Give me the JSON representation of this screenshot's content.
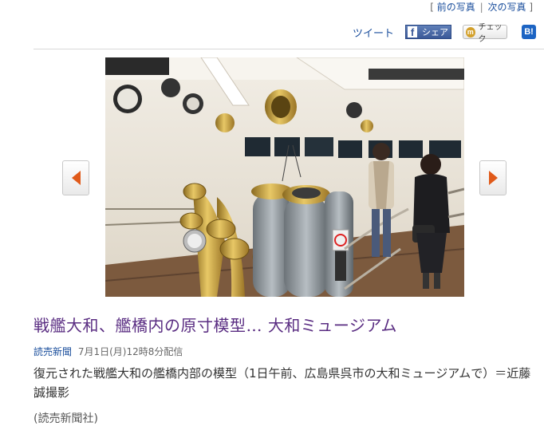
{
  "topnav": {
    "open_bracket": "[",
    "prev_label": "前の写真",
    "separator": "|",
    "next_label": "次の写真",
    "close_bracket": "]"
  },
  "share": {
    "tweet_label": "ツイート",
    "facebook_label": "シェア",
    "mixi_label": "チェック",
    "hatena_label": "B!"
  },
  "article": {
    "headline": "戦艦大和、艦橋内の原寸模型… 大和ミュージアム",
    "source": "読売新聞",
    "date": "7月1日(月)12時8分配信",
    "caption": "復元された戦艦大和の艦橋内部の模型（1日午前、広島県呉市の大和ミュージアムで）＝近藤誠撮影",
    "credit_partial": "(読売新聞社)"
  },
  "colors": {
    "headline": "#5a2d82",
    "link": "#1a4e9c",
    "arrow": "#e05a1a"
  }
}
